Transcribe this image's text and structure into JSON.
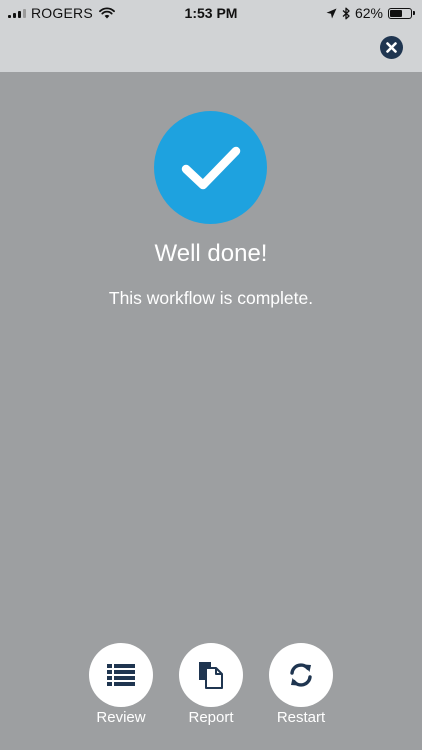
{
  "status_bar": {
    "carrier": "ROGERS",
    "time": "1:53 PM",
    "battery_text": "62%",
    "battery_level": 0.62
  },
  "completion": {
    "title": "Well done!",
    "message": "This workflow is complete."
  },
  "actions": [
    {
      "label": "Review",
      "icon": "list-icon"
    },
    {
      "label": "Report",
      "icon": "document-copy-icon"
    },
    {
      "label": "Restart",
      "icon": "refresh-icon"
    }
  ],
  "colors": {
    "background": "#9d9fa1",
    "header": "#d1d3d5",
    "accent": "#1ea2df",
    "navy": "#1f3550"
  }
}
